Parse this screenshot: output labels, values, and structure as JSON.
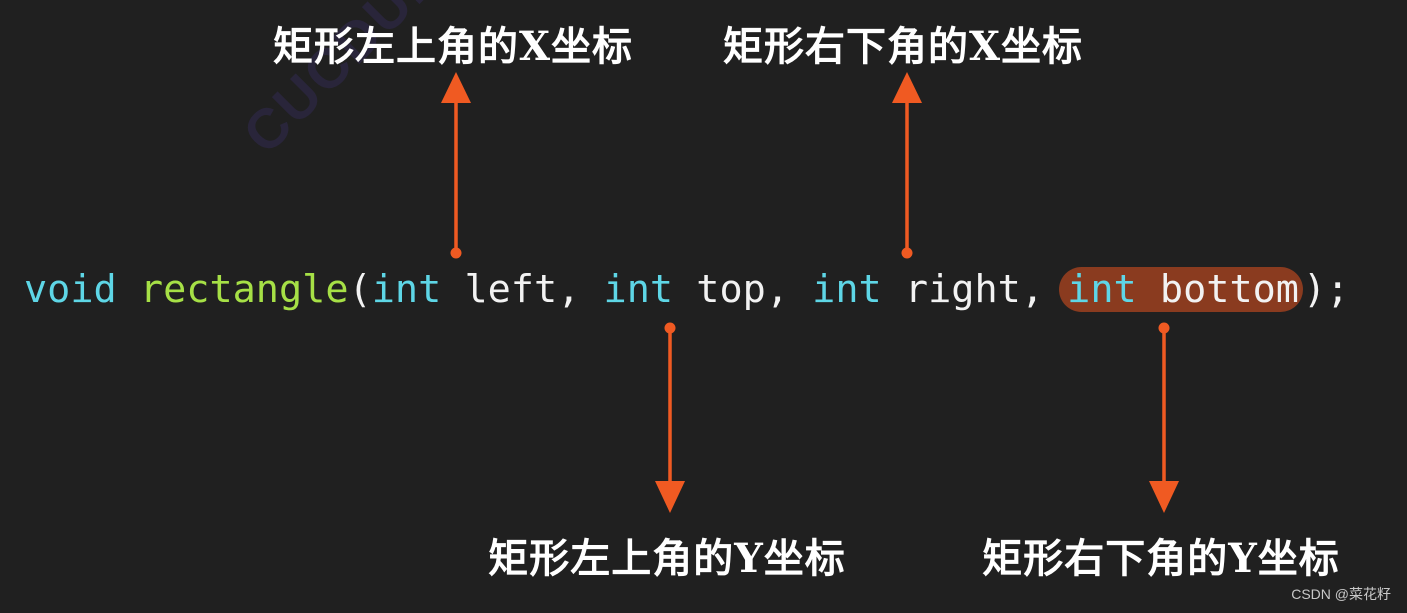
{
  "labels": {
    "top_left_x": "矩形左上角的X坐标",
    "bottom_right_x": "矩形右下角的X坐标",
    "top_left_y": "矩形左上角的Y坐标",
    "bottom_right_y": "矩形右下角的Y坐标"
  },
  "code": {
    "return_type": "void",
    "function_name": "rectangle",
    "open_paren": "(",
    "params": [
      {
        "type": "int",
        "name": "left",
        "sep": ", "
      },
      {
        "type": "int",
        "name": "top",
        "sep": ", "
      },
      {
        "type": "int",
        "name": "right",
        "sep": ", "
      },
      {
        "type": "int",
        "name": "bottom",
        "sep": ""
      }
    ],
    "close": ");",
    "highlighted_param": "int bottom"
  },
  "colors": {
    "background": "#202020",
    "keyword": "#5ed6e6",
    "function": "#a6e046",
    "arrow": "#f05a22",
    "highlight": "#8a3b1f"
  },
  "arrows": [
    {
      "from": "left",
      "to": "top_left_x",
      "direction": "up"
    },
    {
      "from": "right",
      "to": "bottom_right_x",
      "direction": "up"
    },
    {
      "from": "top",
      "to": "top_left_y",
      "direction": "down"
    },
    {
      "from": "bottom",
      "to": "bottom_right_y",
      "direction": "down"
    }
  ],
  "watermark": "CSDN @菜花籽",
  "background_watermark": "CUCDULD"
}
